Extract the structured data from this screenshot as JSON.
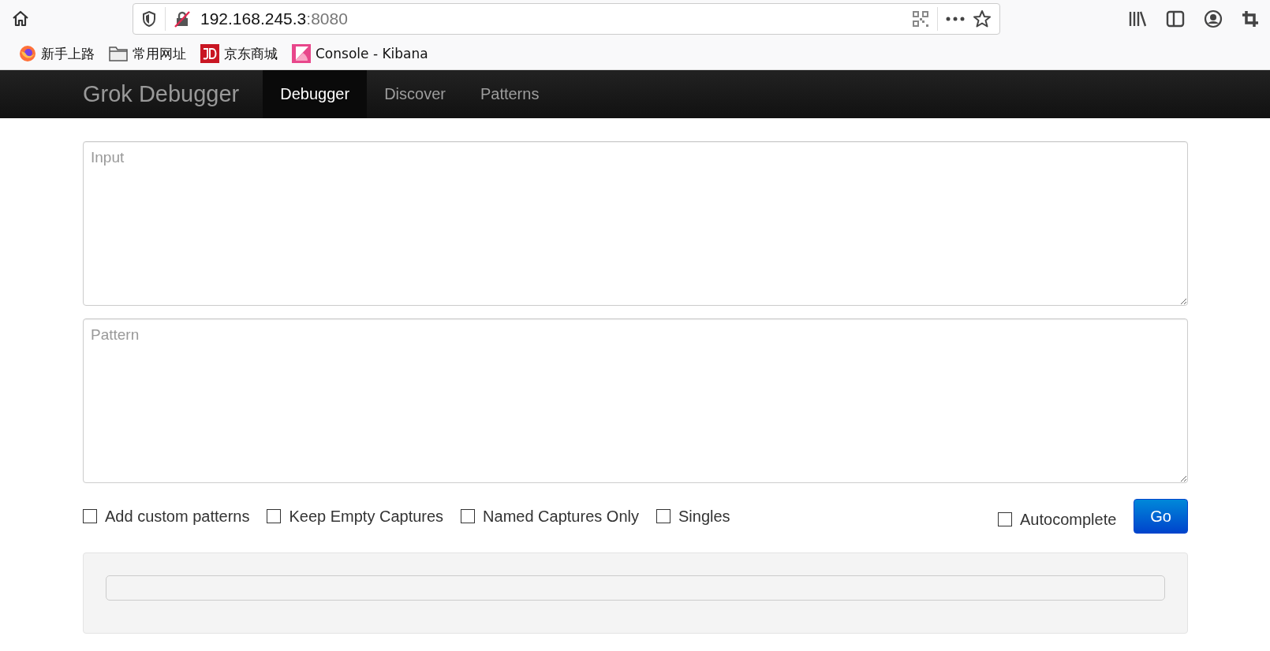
{
  "browser": {
    "url_host": "192.168.245.3",
    "url_port": ":8080",
    "bookmarks": [
      {
        "kind": "firefox",
        "label": "新手上路"
      },
      {
        "kind": "folder",
        "label": "常用网址"
      },
      {
        "kind": "jd",
        "label": "京东商城"
      },
      {
        "kind": "kibana",
        "label": "Console - Kibana"
      }
    ]
  },
  "navbar": {
    "brand": "Grok Debugger",
    "items": [
      {
        "label": "Debugger",
        "selected": true
      },
      {
        "label": "Discover",
        "selected": false
      },
      {
        "label": "Patterns",
        "selected": false
      }
    ]
  },
  "input": {
    "placeholder": "Input"
  },
  "pattern": {
    "placeholder": "Pattern"
  },
  "options": [
    {
      "label": "Add custom patterns",
      "checked": false
    },
    {
      "label": "Keep Empty Captures",
      "checked": false
    },
    {
      "label": "Named Captures Only",
      "checked": false
    },
    {
      "label": "Singles",
      "checked": false
    }
  ],
  "autocomplete": {
    "label": "Autocomplete",
    "checked": false
  },
  "go_button": "Go"
}
